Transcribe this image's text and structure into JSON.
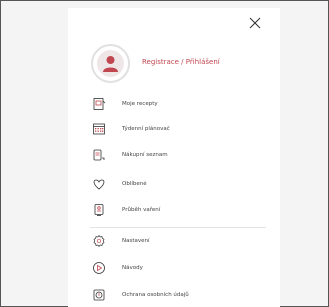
{
  "menu": {
    "login_label": "Registrace / Přihlášení",
    "items": [
      {
        "label": "Moje recepty",
        "icon": "recipe-book-icon"
      },
      {
        "label": "Týdenní plánovač",
        "icon": "calendar-icon"
      },
      {
        "label": "Nákupní seznam",
        "icon": "shopping-list-icon"
      },
      {
        "label": "Oblíbené",
        "icon": "heart-icon"
      },
      {
        "label": "Průběh vaření",
        "icon": "cooking-progress-icon"
      },
      {
        "label": "Nastavení",
        "icon": "gear-icon"
      },
      {
        "label": "Návody",
        "icon": "play-icon"
      },
      {
        "label": "Ochrana osobních údajů",
        "icon": "privacy-shield-icon"
      }
    ]
  },
  "colors": {
    "accent": "#c0474f",
    "icon_stroke": "#333333"
  }
}
